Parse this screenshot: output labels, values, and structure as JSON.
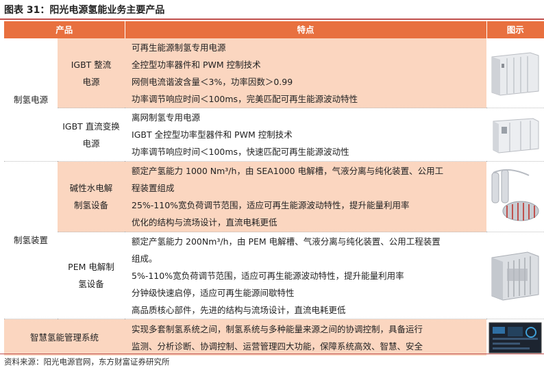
{
  "title": "图表 31：阳光电源氢能业务主要产品",
  "headers": {
    "product": "产品",
    "features": "特点",
    "image": "图示"
  },
  "groups": {
    "power": "制氢电源",
    "device": "制氢装置"
  },
  "rows": [
    {
      "name": "IGBT 整流电源",
      "features": [
        "可再生能源制氢专用电源",
        "全控型功率器件和 PWM 控制技术",
        "网侧电流谐波含量＜3%，功率因数＞0.99",
        "功率调节响应时间＜100ms，完美匹配可再生能源波动特性"
      ]
    },
    {
      "name": "IGBT 直流变换电源",
      "features": [
        "离网制氢专用电源",
        "IGBT 全控型功率型器件和 PWM 控制技术",
        "功率调节响应时间＜100ms，快速匹配可再生能源波动性"
      ]
    },
    {
      "name": "碱性水电解制氢设备",
      "features": [
        "额定产氢能力 1000 Nm³/h，由 SEA1000 电解槽，气液分离与纯化装置、公用工",
        "程装置组成",
        "25%-110%宽负荷调节范围，适应可再生能源波动特性，提升能量利用率",
        "优化的结构与流场设计，直流电耗更低"
      ]
    },
    {
      "name": "PEM 电解制氢设备",
      "features": [
        "额定产氢能力 200Nm³/h，由 PEM 电解槽、气液分离与纯化装置、公用工程装置",
        "组成。",
        "5%-110%宽负荷调节范围，适应可再生能源波动特性，提升能量利用率",
        "分钟级快速启停，适应可再生能源间歇特性",
        "高品质核心部件，先进的结构与流场设计，直流电耗更低"
      ]
    },
    {
      "name": "智慧氢能管理系统",
      "features": [
        "实现多套制氢系统之间，制氢系统与多种能量来源之间的协调控制，具备运行",
        "监测、分析诊断、协调控制、运营管理四大功能，保障系统高效、智慧、安全"
      ]
    }
  ],
  "footer": "资料来源：阳光电源官网，东方财富证券研究所"
}
